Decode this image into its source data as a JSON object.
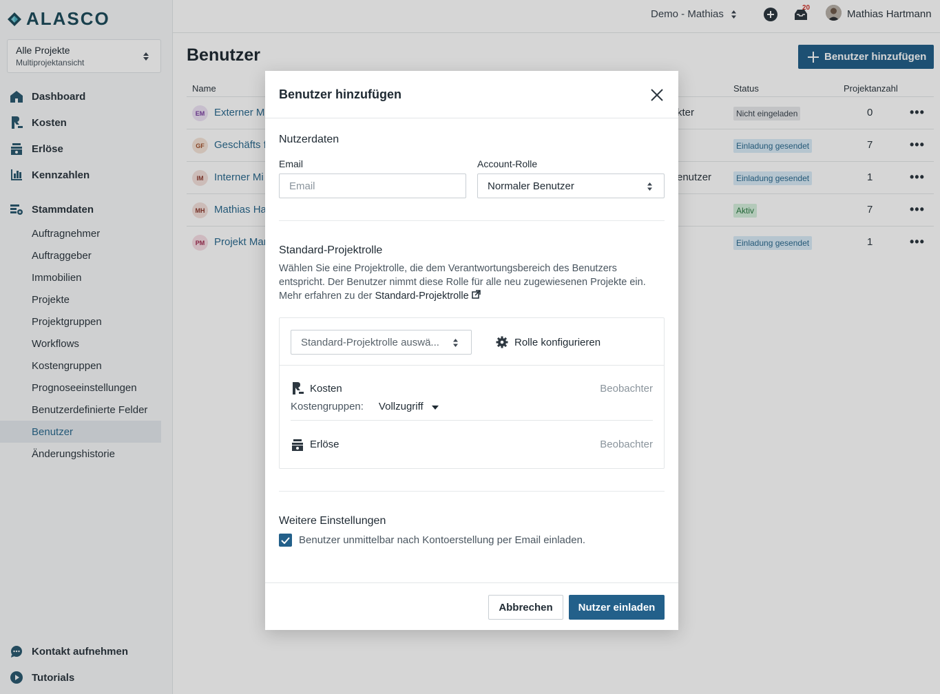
{
  "app": {
    "logo_text": "ALASCO"
  },
  "project_switcher": {
    "title": "Alle Projekte",
    "subtitle": "Multiprojektansicht"
  },
  "nav": {
    "main": [
      {
        "label": "Dashboard",
        "icon": "home-icon"
      },
      {
        "label": "Kosten",
        "icon": "costs-icon"
      },
      {
        "label": "Erlöse",
        "icon": "revenue-icon"
      },
      {
        "label": "Kennzahlen",
        "icon": "chart-icon"
      }
    ],
    "stammdaten_label": "Stammdaten",
    "stammdaten_items": [
      "Auftragnehmer",
      "Auftraggeber",
      "Immobilien",
      "Projekte",
      "Projektgruppen",
      "Workflows",
      "Kostengruppen",
      "Prognoseeinstellungen",
      "Benutzerdefinierte Felder",
      "Benutzer",
      "Änderungshistorie"
    ],
    "active_item": "Benutzer",
    "bottom": [
      {
        "label": "Kontakt aufnehmen",
        "icon": "chat-icon"
      },
      {
        "label": "Tutorials",
        "icon": "play-icon"
      }
    ]
  },
  "topbar": {
    "workspace": "Demo - Mathias",
    "notification_count": "20",
    "user_name": "Mathias Hartmann"
  },
  "page": {
    "title": "Benutzer",
    "add_button": "Benutzer hinzufügen",
    "columns": {
      "name": "Name",
      "status": "Status",
      "count": "Projektanzahl"
    },
    "rows": [
      {
        "initials": "EM",
        "name": "Externer M",
        "role": "kter",
        "status": "Nicht eingeladen",
        "status_type": "grey",
        "count": "0",
        "avatar_bg": "#ede3f5",
        "avatar_fg": "#7a3fa0"
      },
      {
        "initials": "GF",
        "name": "Geschäfts f",
        "role": "",
        "status": "Einladung gesendet",
        "status_type": "blue",
        "count": "7",
        "avatar_bg": "#f5e4d8",
        "avatar_fg": "#a0522d"
      },
      {
        "initials": "IM",
        "name": "Interner Mi",
        "role": "enutzer",
        "status": "Einladung gesendet",
        "status_type": "blue",
        "count": "1",
        "avatar_bg": "#f3e1dc",
        "avatar_fg": "#8b3a2e"
      },
      {
        "initials": "MH",
        "name": "Mathias Ha",
        "role": "",
        "status": "Aktiv",
        "status_type": "green",
        "count": "7",
        "avatar_bg": "#f3e1dc",
        "avatar_fg": "#8b3a2e"
      },
      {
        "initials": "PM",
        "name": "Projekt Mar",
        "role": "",
        "status": "Einladung gesendet",
        "status_type": "blue",
        "count": "1",
        "avatar_bg": "#f6dde4",
        "avatar_fg": "#a02c50"
      }
    ],
    "more_glyph": "•••"
  },
  "modal": {
    "title": "Benutzer hinzufügen",
    "section_user": "Nutzerdaten",
    "email_label": "Email",
    "email_placeholder": "Email",
    "account_role_label": "Account-Rolle",
    "account_role_value": "Normaler Benutzer",
    "section_role": "Standard-Projektrolle",
    "role_description": "Wählen Sie eine Projektrolle, die dem Verantwortungsbereich des Benutzers entspricht. Der Benutzer nimmt diese Rolle für alle neu zugewiesenen Projekte ein.",
    "learn_more_prefix": "Mehr erfahren zu der",
    "learn_more_link": "Standard-Projektrolle",
    "role_select_placeholder": "Standard-Projektrolle auswä...",
    "configure_role": "Rolle konfigurieren",
    "permissions": [
      {
        "name": "Kosten",
        "level": "Beobachter",
        "icon": "costs-icon"
      },
      {
        "name": "Erlöse",
        "level": "Beobachter",
        "icon": "revenue-icon"
      }
    ],
    "cost_groups_label": "Kostengruppen:",
    "cost_groups_value": "Vollzugriff",
    "section_more": "Weitere Einstellungen",
    "invite_checkbox_label": "Benutzer unmittelbar nach Kontoerstellung per Email einladen.",
    "invite_checked": true,
    "cancel_button": "Abbrechen",
    "submit_button": "Nutzer einladen"
  },
  "colors": {
    "primary": "#23608a",
    "link": "#2c6a8f"
  }
}
